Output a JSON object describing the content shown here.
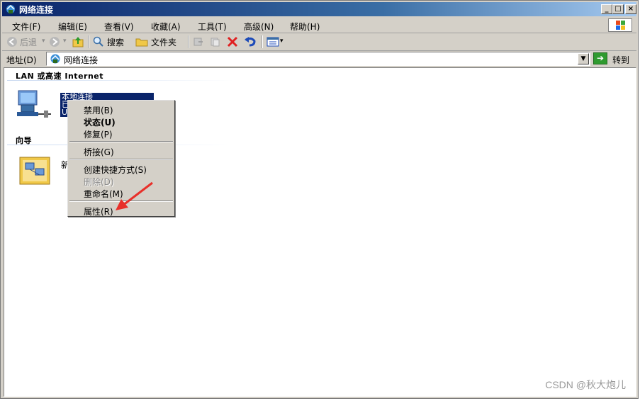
{
  "window": {
    "title": "网络连接",
    "controls": [
      "_",
      "□",
      "×"
    ]
  },
  "menubar": {
    "items": [
      "文件(F)",
      "编辑(E)",
      "查看(V)",
      "收藏(A)",
      "工具(T)",
      "高级(N)",
      "帮助(H)"
    ]
  },
  "toolbar": {
    "back": "后退",
    "search": "搜索",
    "folders": "文件夹"
  },
  "address": {
    "label": "地址(D)",
    "value": "网络连接",
    "go": "转到"
  },
  "groups": {
    "lan": "LAN 或高速 Internet",
    "wizard": "向导"
  },
  "connection": {
    "name": "本地连接",
    "line2": "已",
    "line3": "U"
  },
  "wizard_item": {
    "label": "新"
  },
  "context_menu": {
    "items": [
      {
        "label": "禁用(B)",
        "style": "normal"
      },
      {
        "label": "状态(U)",
        "style": "bold"
      },
      {
        "label": "修复(P)",
        "style": "normal"
      },
      {
        "label": "桥接(G)",
        "style": "normal"
      },
      {
        "label": "创建快捷方式(S)",
        "style": "normal"
      },
      {
        "label": "删除(D)",
        "style": "disabled"
      },
      {
        "label": "重命名(M)",
        "style": "normal"
      },
      {
        "label": "属性(R)",
        "style": "normal"
      }
    ]
  },
  "colors": {
    "title_bar": "#0a246a",
    "arrow": "#e8302a"
  },
  "watermark": "CSDN @秋大炮儿"
}
